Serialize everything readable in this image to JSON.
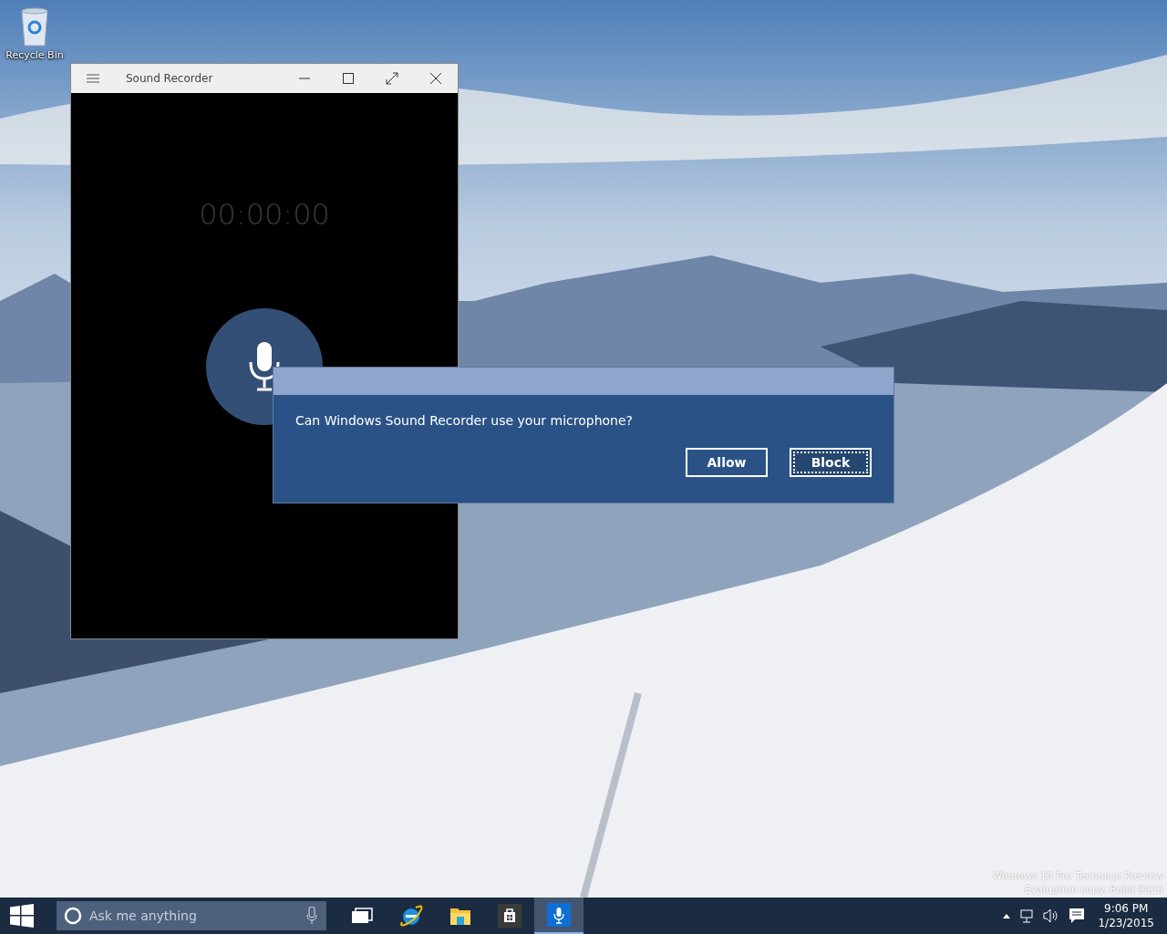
{
  "desktop": {
    "icons": [
      {
        "label": "Recycle Bin"
      }
    ],
    "build_info": [
      "Windows 10 Pro Technical Preview",
      "Evaluation copy. Build 9926"
    ]
  },
  "app_window": {
    "title": "Sound Recorder",
    "timer": "00:00:00"
  },
  "dialog": {
    "message": "Can Windows Sound Recorder use your microphone?",
    "buttons": [
      {
        "label": "Allow",
        "selected": false
      },
      {
        "label": "Block",
        "selected": true
      }
    ]
  },
  "taskbar": {
    "search": {
      "placeholder": "Ask me anything"
    },
    "apps": [
      {
        "kind": "task-view",
        "active": false
      },
      {
        "kind": "browser",
        "active": false
      },
      {
        "kind": "explorer",
        "active": false
      },
      {
        "kind": "store",
        "active": false
      },
      {
        "kind": "recorder",
        "active": true
      }
    ],
    "tray": {
      "time": "9:06 PM",
      "date": "1/23/2015"
    }
  }
}
